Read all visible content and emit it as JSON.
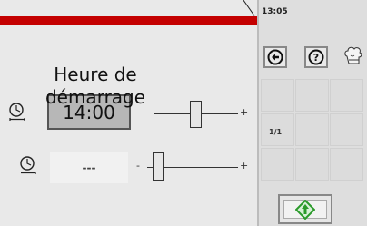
{
  "header": {
    "time": "13:05"
  },
  "toolbar": {
    "back": "back-icon",
    "help": "help-icon",
    "chef": "chef-icon"
  },
  "pagination": {
    "page": "1/1"
  },
  "setting": {
    "label_line1": "Heure de",
    "label_line2": "démarrage",
    "start_time_value": "14:00",
    "slider_plus": "+",
    "second_value": "---",
    "second_minus": "-",
    "second_plus": "+"
  },
  "colors": {
    "accent": "#c40000",
    "start_button": "#2a9a2a"
  }
}
